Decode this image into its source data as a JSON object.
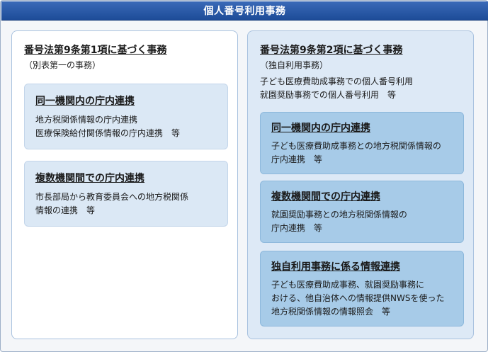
{
  "header": {
    "title": "個人番号利用事務"
  },
  "left": {
    "title": "番号法第9条第1項に基づく事務",
    "subtitle": "（別表第一の事務）",
    "boxes": [
      {
        "title": "同一機関内の庁内連携",
        "lines": [
          "地方税関係情報の庁内連携",
          "医療保険給付関係情報の庁内連携　等"
        ]
      },
      {
        "title": "複数機関間での庁内連携",
        "lines": [
          "市長部局から教育委員会への地方税関係",
          "情報の連携　等"
        ]
      }
    ]
  },
  "right": {
    "title": "番号法第9条第2項に基づく事務",
    "subtitle": "（独自利用事務）",
    "desc": [
      "子ども医療費助成事務での個人番号利用",
      "就園奨励事務での個人番号利用　等"
    ],
    "boxes": [
      {
        "title": "同一機関内の庁内連携",
        "lines": [
          "子ども医療費助成事務との地方税関係情報の",
          "庁内連携　等"
        ]
      },
      {
        "title": "複数機関間での庁内連携",
        "lines": [
          "就園奨励事務との地方税関係情報の",
          "庁内連携　等"
        ]
      },
      {
        "title": "独自利用事務に係る情報連携",
        "lines": [
          "子ども医療費助成事務、就園奨励事務に",
          "おける、他自治体への情報提供NWSを使った",
          "地方税関係情報の情報照会　等"
        ]
      }
    ]
  }
}
